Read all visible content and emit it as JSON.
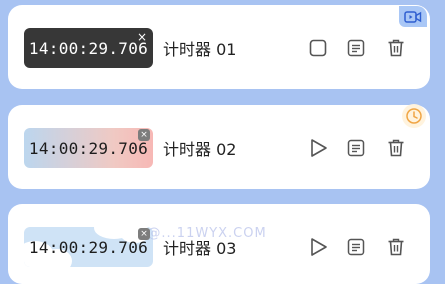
{
  "timers": [
    {
      "time": "14:00:29.706",
      "name": "计时器 01",
      "state": "stopped"
    },
    {
      "time": "14:00:29.706",
      "name": "计时器 02",
      "state": "play"
    },
    {
      "time": "14:00:29.706",
      "name": "计时器 03",
      "state": "play"
    }
  ],
  "icons": {
    "close": "×",
    "corner_video": "video-icon",
    "corner_clock": "clock-icon"
  },
  "watermark": "11W@...11WYX.COM",
  "colors": {
    "background": "#a8c3f2",
    "card": "#ffffff",
    "dark_badge": "#373737",
    "clock_accent": "#f0a544"
  }
}
